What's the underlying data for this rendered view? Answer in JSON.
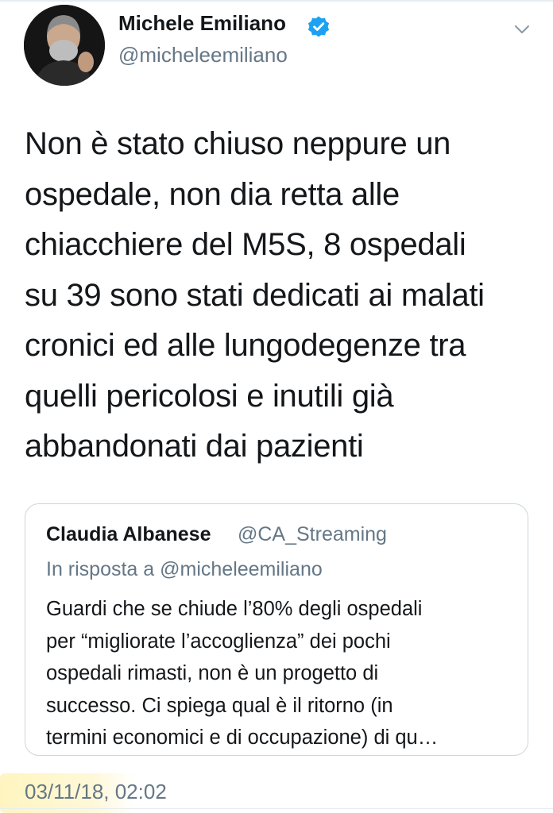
{
  "tweet": {
    "author_name": "Michele Emiliano",
    "author_handle": "@micheleemiliano",
    "text_lines": [
      "Non è stato chiuso neppure un",
      "ospedale, non dia retta alle",
      "chiacchiere del M5S, 8 ospedali",
      "su 39 sono stati dedicati ai malati",
      "cronici ed alle lungodegenze tra",
      "quelli pericolosi e inutili già",
      "abbandonati dai pazienti"
    ],
    "timestamp": "03/11/18, 02:02"
  },
  "quoted_tweet": {
    "author_name": "Claudia Albanese",
    "author_handle": "@CA_Streaming",
    "reply_context": "In risposta a @micheleemiliano",
    "text_lines": [
      "Guardi che se chiude l’80% degli ospedali",
      "per “migliorate l’accoglienza” dei pochi",
      "ospedali rimasti, non è un progetto di",
      "successo. Ci spiega qual è il ritorno (in",
      "termini economici e di occupazione) di qu…"
    ]
  },
  "icons": {
    "verified": "verified-badge-icon",
    "menu": "chevron-down-icon"
  },
  "colors": {
    "verified_blue": "#1da1f2",
    "secondary_text": "#657786",
    "highlight": "#ffec8c"
  }
}
